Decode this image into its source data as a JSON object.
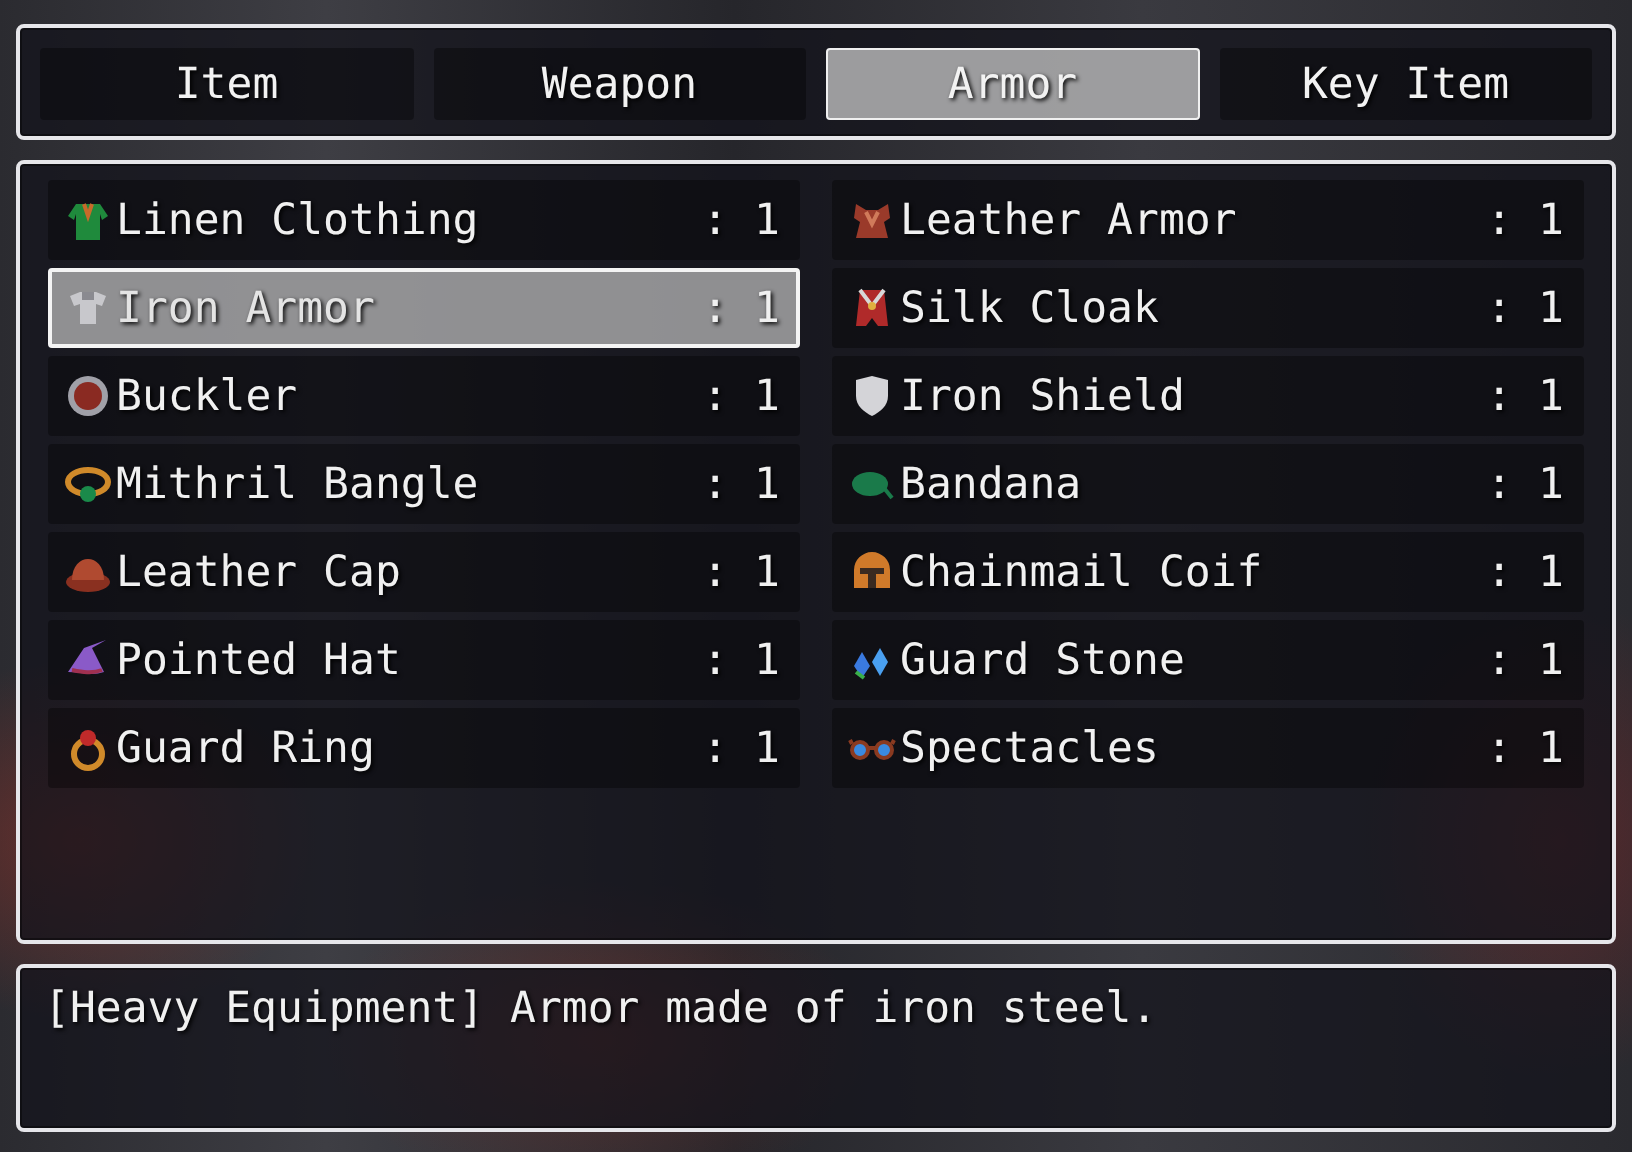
{
  "tabs": [
    {
      "label": "Item",
      "selected": false
    },
    {
      "label": "Weapon",
      "selected": false
    },
    {
      "label": "Armor",
      "selected": true
    },
    {
      "label": "Key Item",
      "selected": false
    }
  ],
  "items": [
    {
      "name": "Linen Clothing",
      "count": ": 1",
      "kind": "robe",
      "selected": false
    },
    {
      "name": "Leather Armor",
      "count": ": 1",
      "kind": "vest",
      "selected": false
    },
    {
      "name": "Iron Armor",
      "count": ": 1",
      "kind": "armor",
      "selected": true
    },
    {
      "name": "Silk Cloak",
      "count": ": 1",
      "kind": "cloak",
      "selected": false
    },
    {
      "name": "Buckler",
      "count": ": 1",
      "kind": "buckler",
      "selected": false
    },
    {
      "name": "Iron Shield",
      "count": ": 1",
      "kind": "shield",
      "selected": false
    },
    {
      "name": "Mithril Bangle",
      "count": ": 1",
      "kind": "bangle",
      "selected": false
    },
    {
      "name": "Bandana",
      "count": ": 1",
      "kind": "bandana",
      "selected": false
    },
    {
      "name": "Leather Cap",
      "count": ": 1",
      "kind": "cap",
      "selected": false
    },
    {
      "name": "Chainmail Coif",
      "count": ": 1",
      "kind": "helmet",
      "selected": false
    },
    {
      "name": "Pointed Hat",
      "count": ": 1",
      "kind": "hat",
      "selected": false
    },
    {
      "name": "Guard Stone",
      "count": ": 1",
      "kind": "gems",
      "selected": false
    },
    {
      "name": "Guard Ring",
      "count": ": 1",
      "kind": "ring",
      "selected": false
    },
    {
      "name": "Spectacles",
      "count": ": 1",
      "kind": "glasses",
      "selected": false
    }
  ],
  "help": {
    "text": "[Heavy Equipment] Armor made of iron steel."
  }
}
